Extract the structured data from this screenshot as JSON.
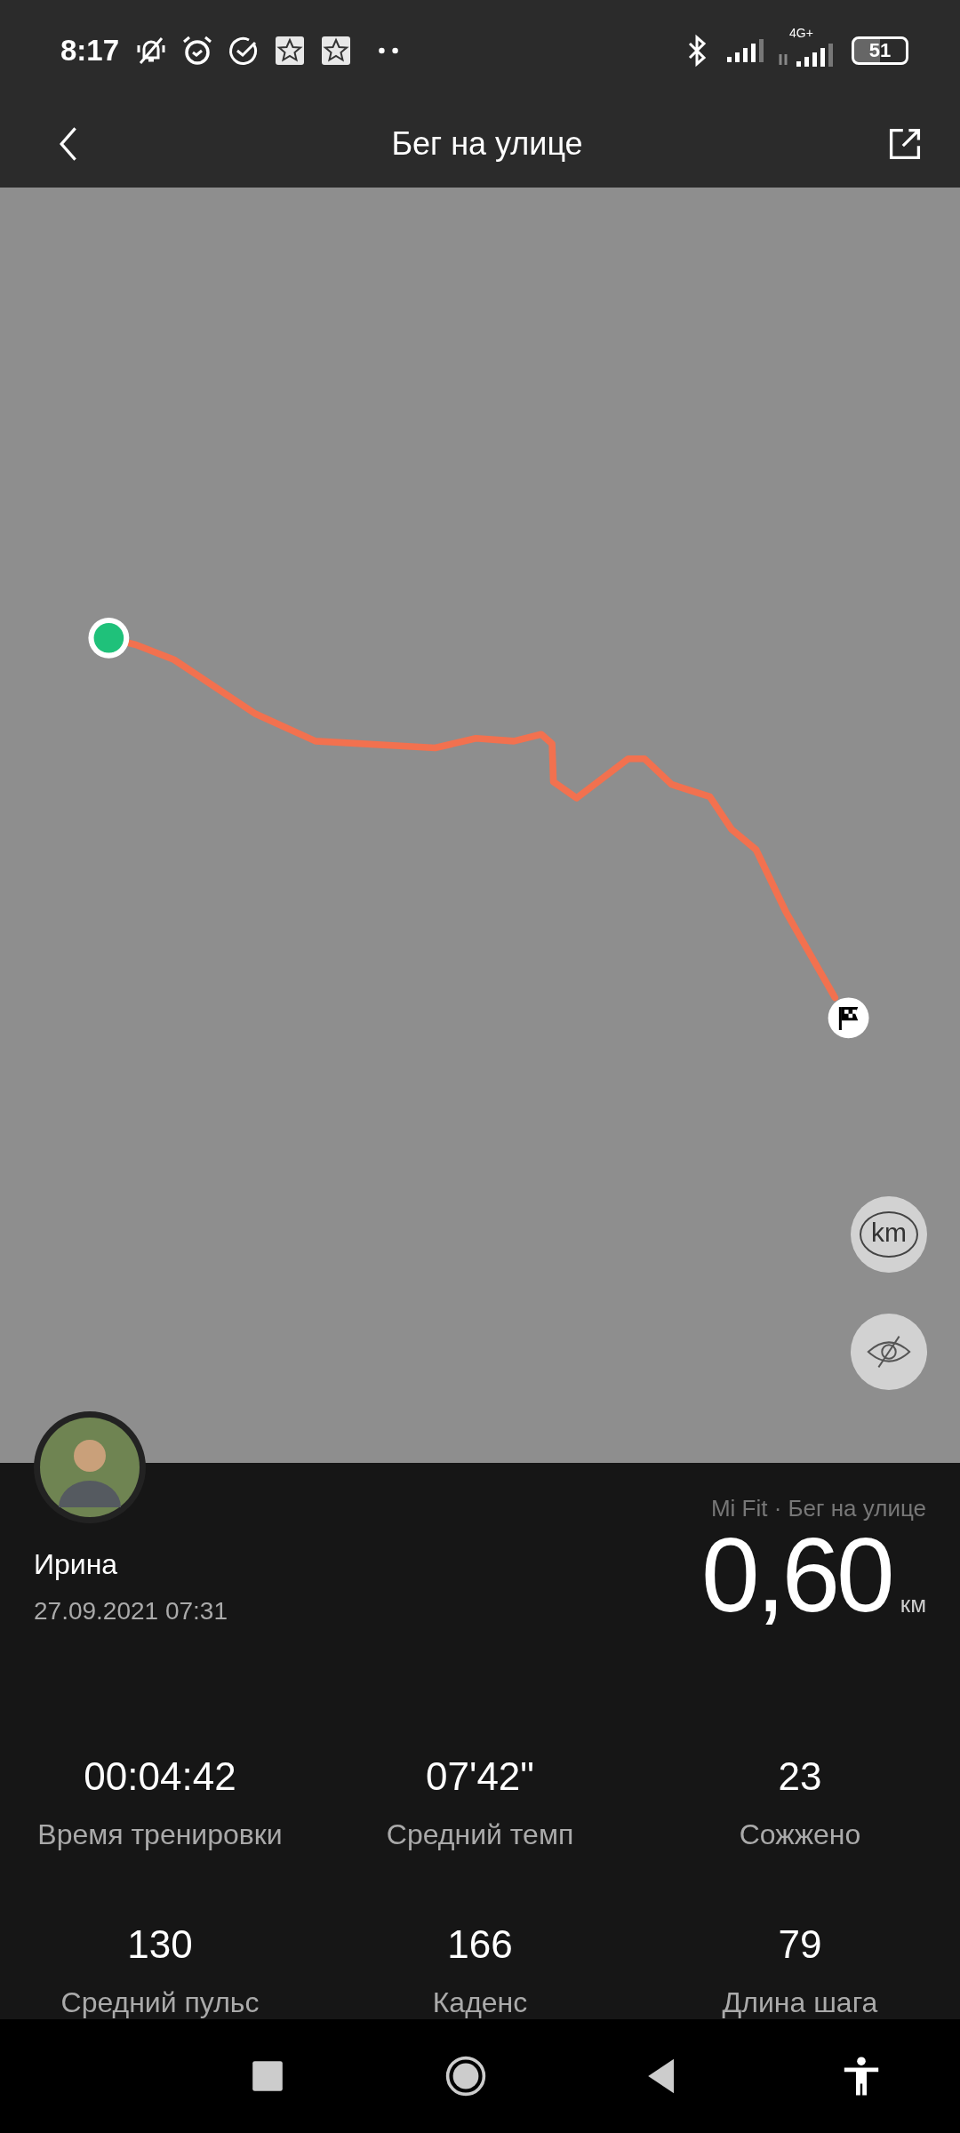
{
  "status_bar": {
    "time": "8:17",
    "network": "4G+",
    "battery": "51"
  },
  "header": {
    "title": "Бег на улице"
  },
  "map": {
    "controls": [
      {
        "kind": "units",
        "label": "km"
      },
      {
        "kind": "hide"
      }
    ]
  },
  "summary": {
    "user_name": "Ирина",
    "date": "27.09.2021 07:31",
    "source": "Mi Fit · Бег на улице",
    "distance": "0,60",
    "distance_unit": "км"
  },
  "stats": [
    {
      "value": "00:04:42",
      "label": "Время тренировки"
    },
    {
      "value": "07'42\"",
      "label": "Средний темп"
    },
    {
      "value": "23",
      "label": "Сожжено"
    },
    {
      "value": "130",
      "label": "Средний пульс"
    },
    {
      "value": "166",
      "label": "Каденс"
    },
    {
      "value": "79",
      "label": "Длина шага"
    }
  ]
}
